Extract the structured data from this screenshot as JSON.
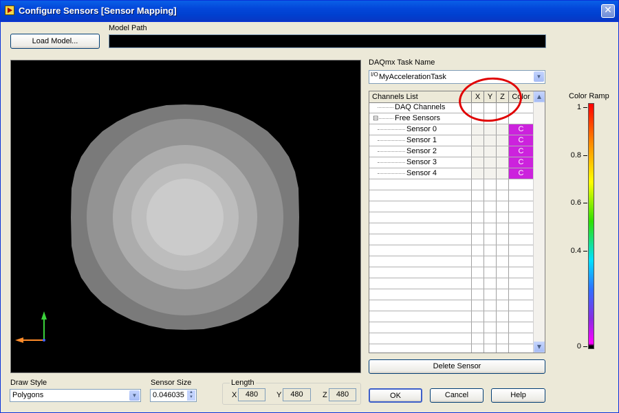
{
  "window": {
    "title": "Configure Sensors [Sensor Mapping]",
    "close_glyph": "✕"
  },
  "model": {
    "load_label": "Load Model...",
    "path_label": "Model Path",
    "path_value": ""
  },
  "daq": {
    "label": "DAQmx Task Name",
    "io_glyph": "I/O",
    "task_value": "MyAccelerationTask"
  },
  "table": {
    "headers": [
      "Channels List",
      "X",
      "Y",
      "Z",
      "Color"
    ],
    "rows": [
      {
        "name": "DAQ Channels",
        "expander": "",
        "color": ""
      },
      {
        "name": "Free Sensors",
        "expander": "⊟",
        "color": ""
      },
      {
        "name": "Sensor 0",
        "expander": "",
        "color": "C"
      },
      {
        "name": "Sensor 1",
        "expander": "",
        "color": "C"
      },
      {
        "name": "Sensor 2",
        "expander": "",
        "color": "C"
      },
      {
        "name": "Sensor 3",
        "expander": "",
        "color": "C"
      },
      {
        "name": "Sensor 4",
        "expander": "",
        "color": "C"
      }
    ],
    "sensor_color": "#cc22dd"
  },
  "delete_label": "Delete Sensor",
  "draw_style": {
    "label": "Draw Style",
    "value": "Polygons"
  },
  "sensor_size": {
    "label": "Sensor Size",
    "value": "0.046035"
  },
  "length": {
    "label": "Length",
    "x_label": "X",
    "x": "480",
    "y_label": "Y",
    "y": "480",
    "z_label": "Z",
    "z": "480"
  },
  "buttons": {
    "ok": "OK",
    "cancel": "Cancel",
    "help": "Help"
  },
  "color_ramp": {
    "label": "Color Ramp",
    "ticks": [
      "1",
      "0.8",
      "0.6",
      "0.4",
      "0"
    ]
  },
  "icons": {
    "close": "close-icon",
    "dropdown": "chevron-down-icon",
    "axes": "axes-icon"
  }
}
